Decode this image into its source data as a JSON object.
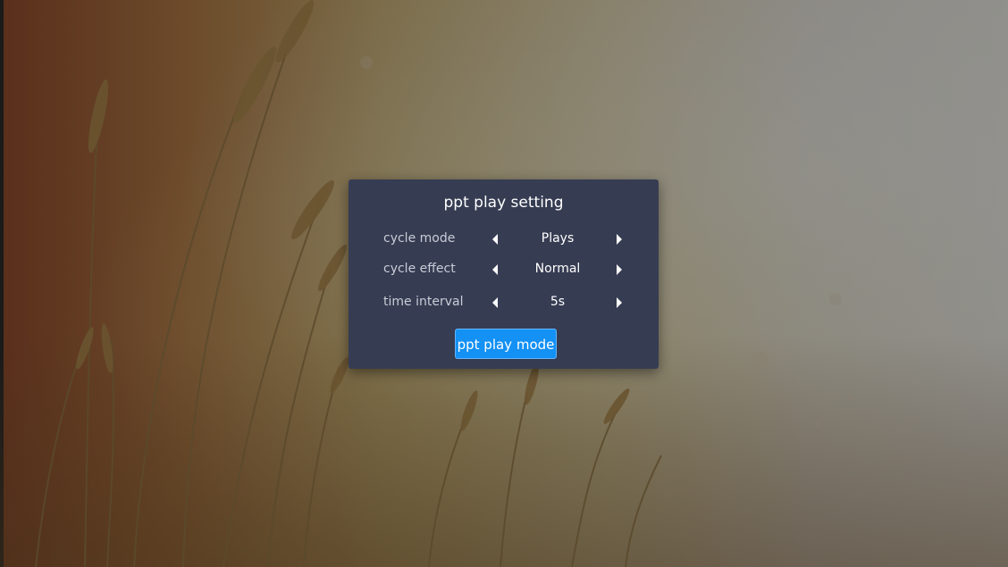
{
  "dialog": {
    "title": "ppt play setting",
    "rows": [
      {
        "label": "cycle mode",
        "value": "Plays"
      },
      {
        "label": "cycle effect",
        "value": "Normal"
      },
      {
        "label": "time interval",
        "value": "5s"
      }
    ],
    "button_label": "ppt play mode"
  },
  "colors": {
    "dialog_background": "#363c52",
    "button_background": "#1391f4",
    "label_text": "#c9ccd6",
    "value_text": "#ffffff"
  },
  "icons": {
    "decrease": "left-arrow-icon",
    "increase": "right-arrow-icon"
  }
}
